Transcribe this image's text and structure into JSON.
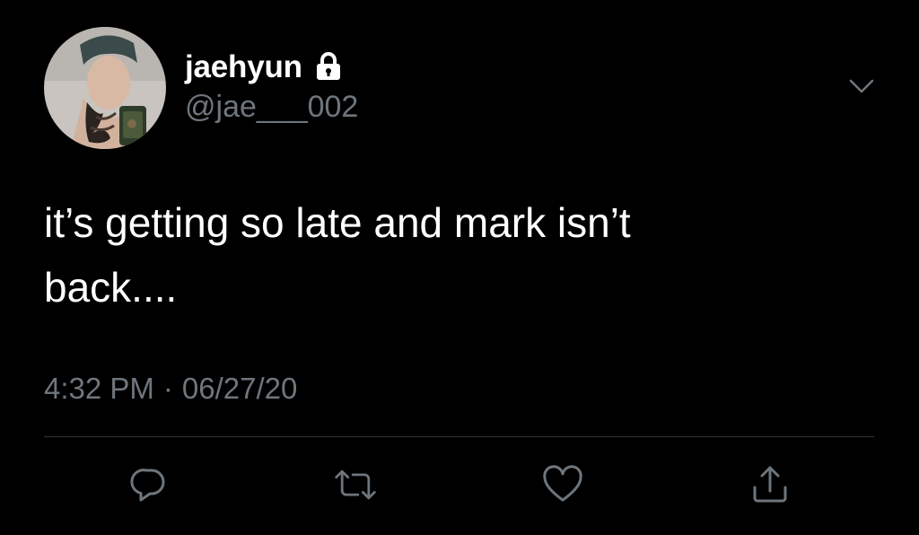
{
  "user": {
    "display_name": "jaehyun",
    "handle": "@jae___002",
    "protected_icon": "lock-icon"
  },
  "tweet": {
    "text": "it’s getting so late and mark isn’t\nback....",
    "time": "4:32 PM",
    "separator": "·",
    "date": "06/27/20"
  },
  "actions": [
    {
      "name": "reply",
      "icon": "reply-bubble-icon"
    },
    {
      "name": "retweet",
      "icon": "retweet-icon"
    },
    {
      "name": "like",
      "icon": "heart-icon"
    },
    {
      "name": "share",
      "icon": "share-upload-icon"
    }
  ],
  "colors": {
    "background": "#000000",
    "text": "#ffffff",
    "secondary": "#6e767d",
    "divider": "#2f3336"
  }
}
